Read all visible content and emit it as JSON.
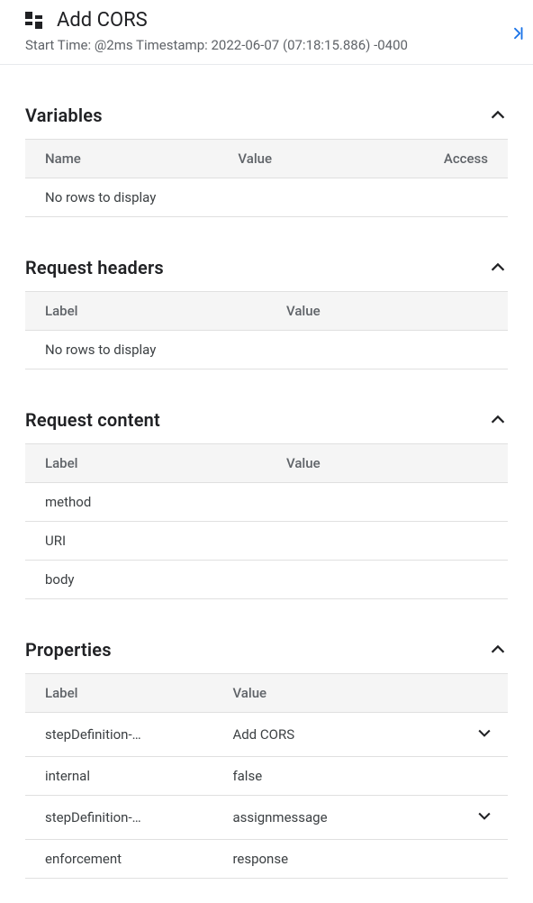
{
  "header": {
    "title": "Add CORS",
    "start_time": "Start Time: @2ms Timestamp: 2022-06-07 (07:18:15.886) -0400"
  },
  "sections": {
    "variables": {
      "title": "Variables",
      "columns": {
        "name": "Name",
        "value": "Value",
        "access": "Access"
      },
      "empty": "No rows to display"
    },
    "request_headers": {
      "title": "Request headers",
      "columns": {
        "label": "Label",
        "value": "Value"
      },
      "empty": "No rows to display"
    },
    "request_content": {
      "title": "Request content",
      "columns": {
        "label": "Label",
        "value": "Value"
      },
      "rows": [
        {
          "label": "method",
          "value": ""
        },
        {
          "label": "URI",
          "value": ""
        },
        {
          "label": "body",
          "value": ""
        }
      ]
    },
    "properties": {
      "title": "Properties",
      "columns": {
        "label": "Label",
        "value": "Value"
      },
      "rows": [
        {
          "label": "stepDefinition-…",
          "value": "Add CORS",
          "expandable": true
        },
        {
          "label": "internal",
          "value": "false",
          "expandable": false
        },
        {
          "label": "stepDefinition-…",
          "value": "assignmessage",
          "expandable": true
        },
        {
          "label": "enforcement",
          "value": "response",
          "expandable": false
        }
      ]
    }
  }
}
